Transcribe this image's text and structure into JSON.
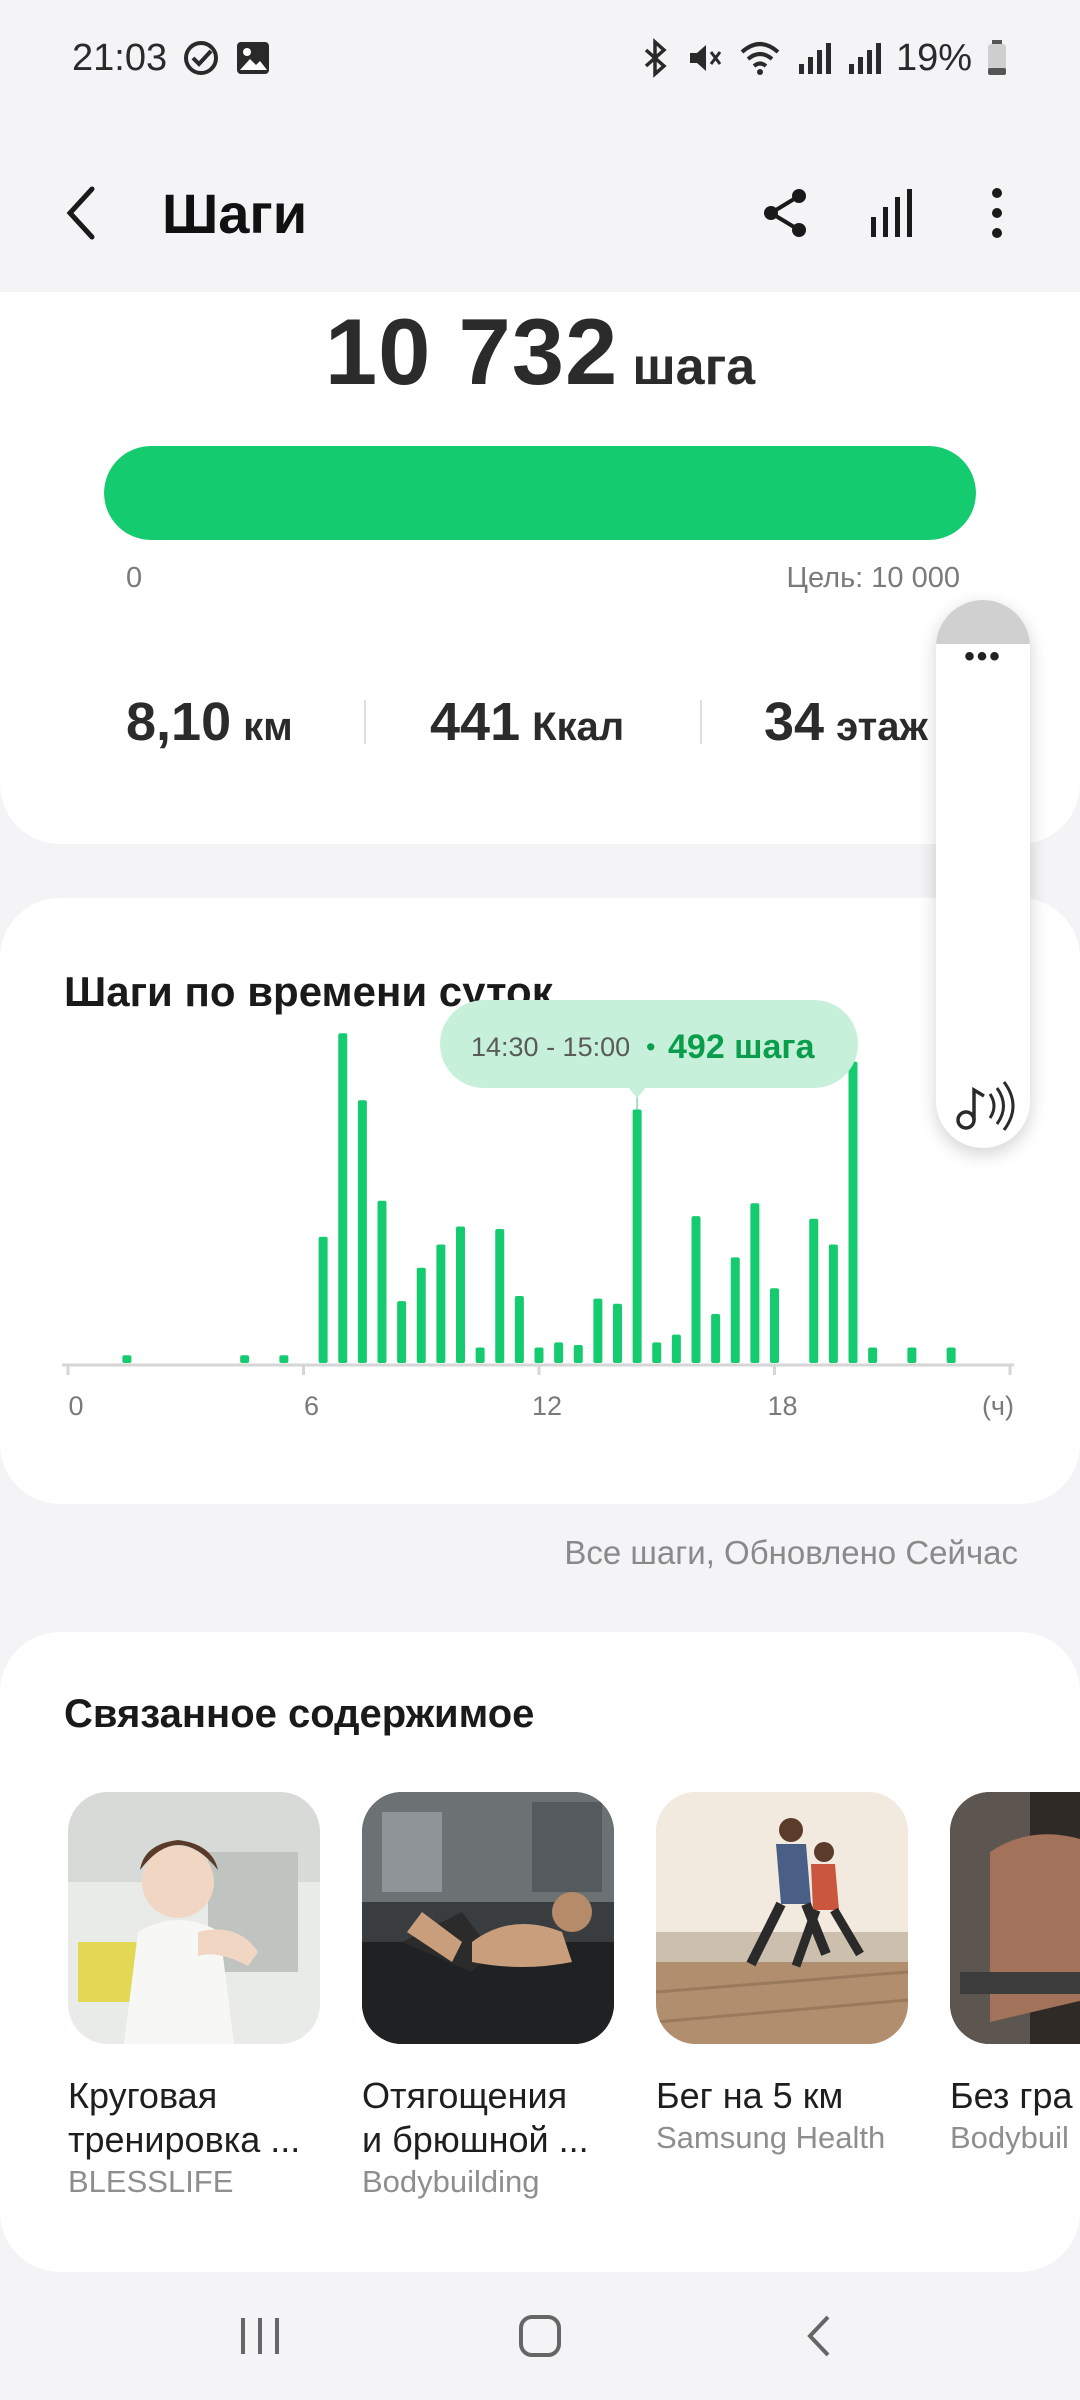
{
  "status_bar": {
    "time": "21:03",
    "battery": "19%",
    "icons": [
      "check-circle-icon",
      "gallery-icon",
      "bluetooth-icon",
      "mute-icon",
      "wifi-icon",
      "signal-icon",
      "battery-icon"
    ]
  },
  "header": {
    "title": "Шаги",
    "actions": [
      "share-icon",
      "stats-icon",
      "more-icon"
    ]
  },
  "summary": {
    "steps": "10 732",
    "steps_unit": "шага",
    "progress_min": "0",
    "goal_label": "Цель: 10 000",
    "progress_fraction": 1.0,
    "stats": [
      {
        "value": "8,10",
        "unit": "км"
      },
      {
        "value": "441",
        "unit": "Ккал"
      },
      {
        "value": "34",
        "unit": "этаж"
      }
    ]
  },
  "floating_panel": {
    "more": "•••",
    "icons": [
      "more-icon",
      "sound-assistant-icon"
    ]
  },
  "chart": {
    "title": "Шаги по времени суток",
    "tooltip_time": "14:30 - 15:00",
    "tooltip_value": "492 шага",
    "footnote": "Все шаги, Обновлено Сейчас"
  },
  "chart_data": {
    "type": "bar",
    "title": "Шаги по времени суток",
    "x_ticks": [
      "0",
      "6",
      "12",
      "18",
      "(ч)"
    ],
    "x": [
      1.5,
      4.5,
      5.5,
      6.5,
      7.0,
      7.5,
      8.0,
      8.5,
      9.0,
      9.5,
      10.0,
      10.5,
      11.0,
      11.5,
      12.0,
      12.5,
      13.0,
      13.5,
      14.0,
      14.5,
      15.0,
      15.5,
      16.0,
      16.5,
      17.0,
      17.5,
      18.0,
      19.0,
      19.5,
      20.0,
      20.5,
      21.5,
      22.5
    ],
    "values": [
      15,
      15,
      15,
      245,
      640,
      510,
      315,
      120,
      185,
      230,
      265,
      30,
      260,
      130,
      30,
      40,
      35,
      125,
      115,
      492,
      40,
      55,
      285,
      95,
      205,
      310,
      145,
      280,
      230,
      585,
      30,
      30,
      30
    ],
    "xlim": [
      0,
      24
    ],
    "highlight": {
      "x": 14.5,
      "value": 492,
      "label": "14:30 - 15:00"
    },
    "colors": {
      "bar": "#14cc6f",
      "tooltip_bg": "#c7f0da",
      "tooltip_value": "#0a9e4c"
    }
  },
  "related": {
    "title": "Связанное содержимое",
    "items": [
      {
        "name_line1": "Круговая",
        "name_line2": "тренировка ...",
        "source": "BLESSLIFE",
        "image": "woman-stretching-gym-photo"
      },
      {
        "name_line1": "Отягощения",
        "name_line2": "и брюшной ...",
        "source": "Bodybuilding",
        "image": "man-crunches-gym-photo"
      },
      {
        "name_line1": "Бег на 5 км",
        "name_line2": "",
        "source": "Samsung Health",
        "image": "couple-running-photo"
      },
      {
        "name_line1": "Без гра",
        "name_line2": "",
        "source": "Bodybuil",
        "image": "bodybuilder-photo"
      }
    ]
  },
  "nav": {
    "items": [
      "recents-icon",
      "home-icon",
      "back-icon"
    ]
  }
}
